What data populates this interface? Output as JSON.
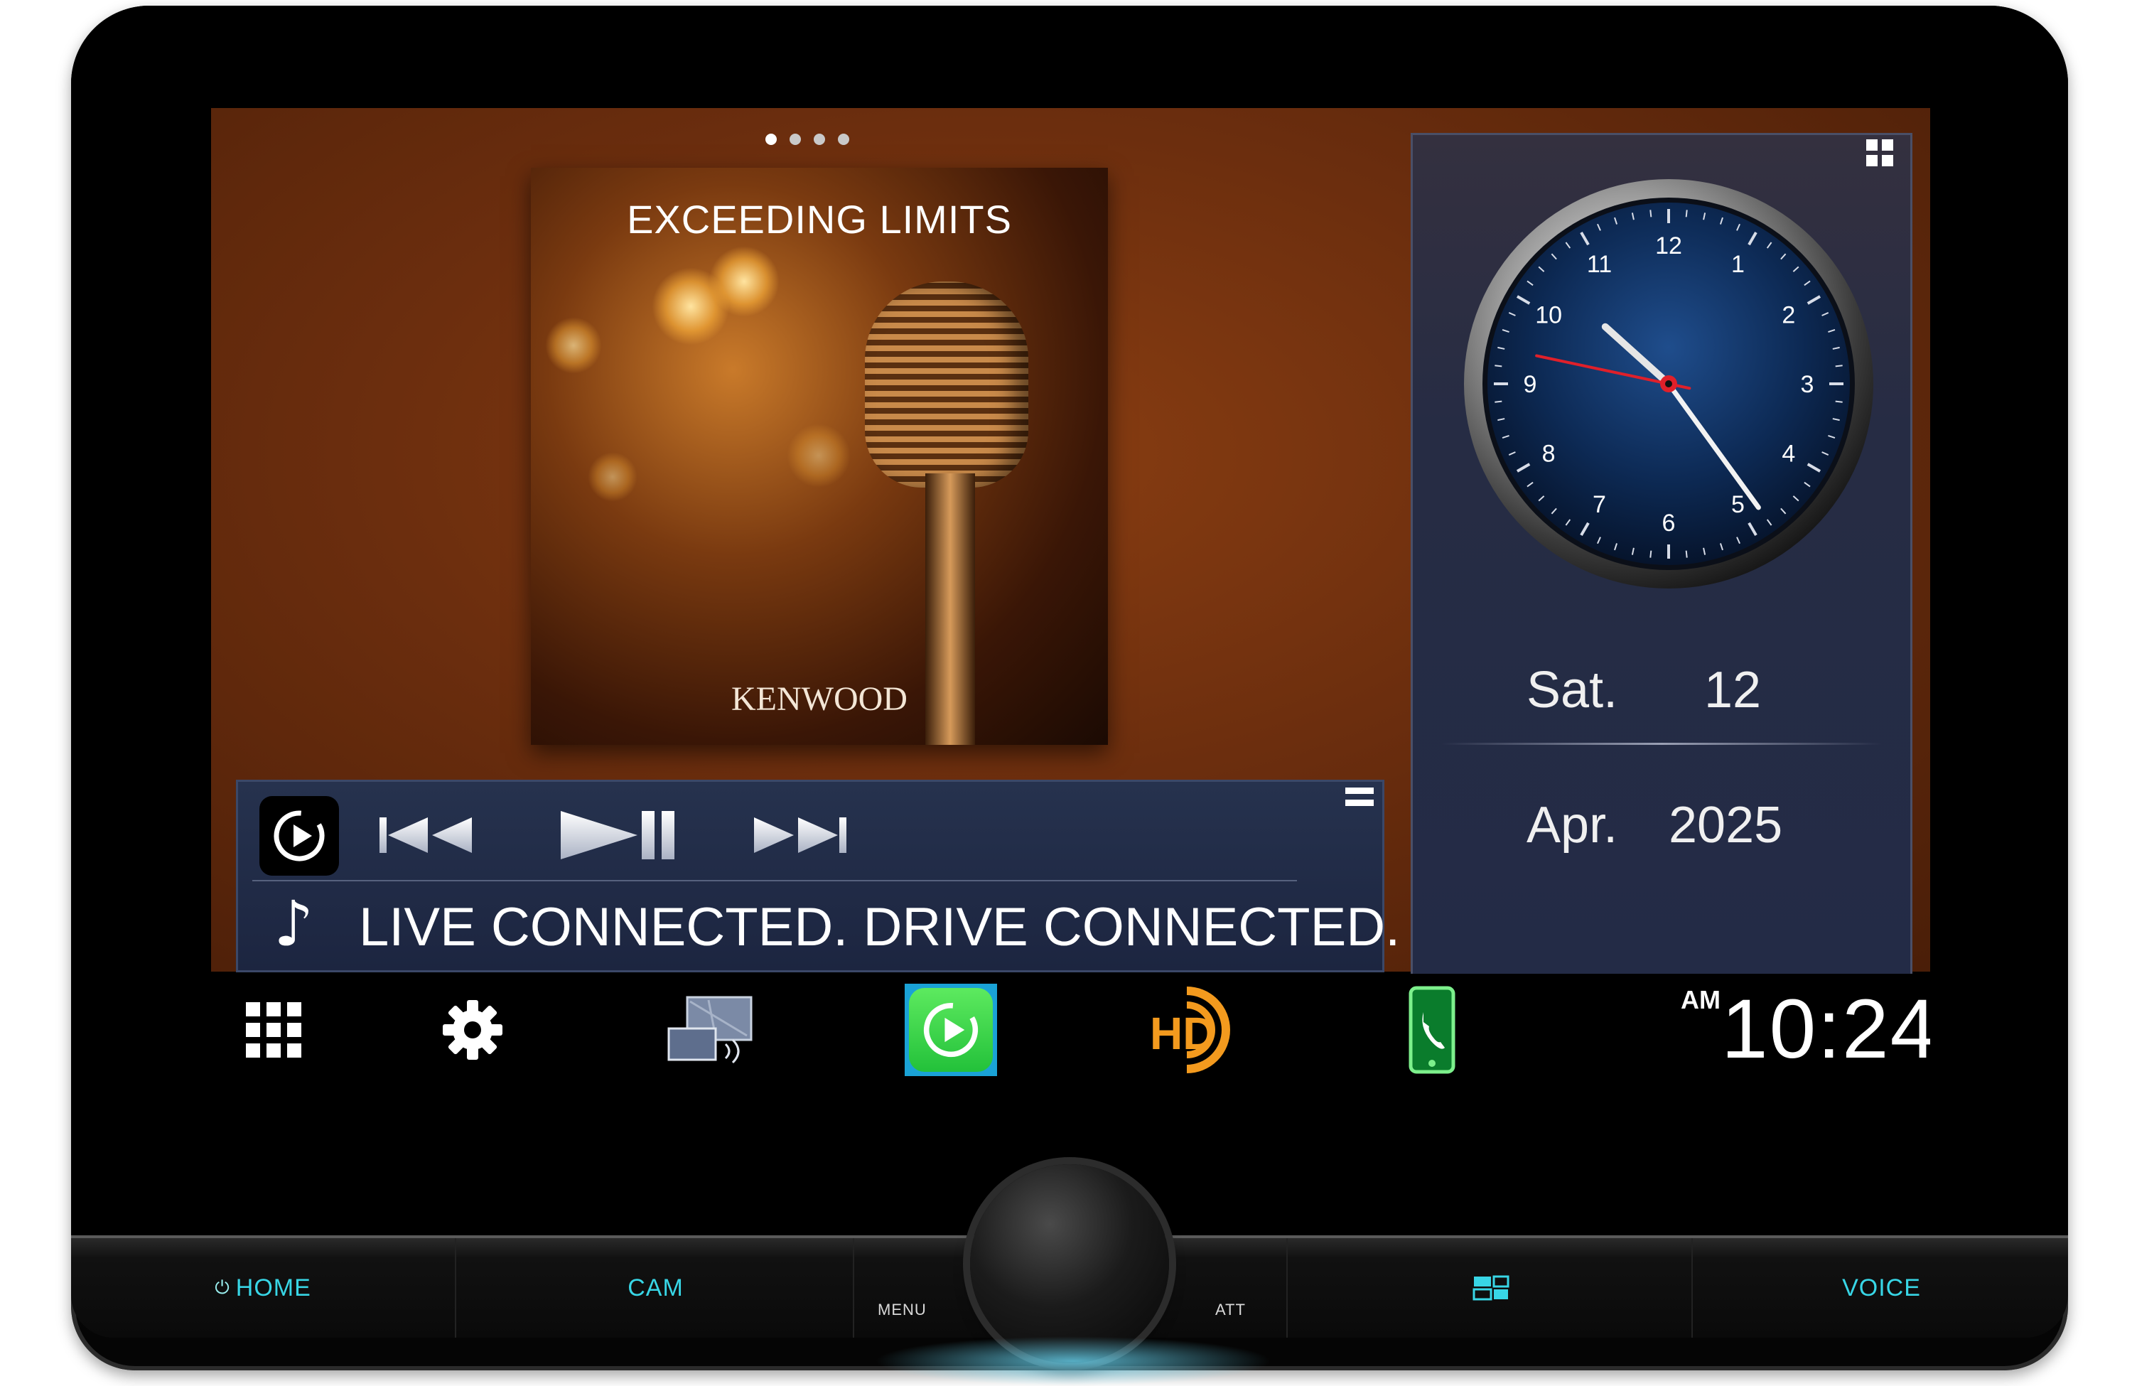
{
  "album": {
    "title": "EXCEEDING LIMITS",
    "brand": "KENWOOD"
  },
  "player": {
    "track_line": "LIVE CONNECTED. DRIVE CONNECTED.",
    "note_glyph": "♪",
    "source_icon": "carplay-icon",
    "controls": [
      "previous-icon",
      "play-pause-icon",
      "next-icon"
    ]
  },
  "page_indicator": {
    "pages": 4,
    "active": 1
  },
  "clock_widget": {
    "hour_numbers": [
      "12",
      "1",
      "2",
      "3",
      "4",
      "5",
      "6",
      "7",
      "8",
      "9",
      "10",
      "11"
    ],
    "time_shown": "10:24",
    "weekday": "Sat.",
    "day": "12",
    "month": "Apr.",
    "year": "2025"
  },
  "dock": {
    "items": [
      "apps-grid-icon",
      "settings-gear-icon",
      "screen-mirroring-icon",
      "carplay-icon",
      "hd-radio-icon",
      "phone-icon"
    ],
    "ampm": "AM",
    "time": "10:24"
  },
  "hardware": {
    "home": "HOME",
    "cam": "CAM",
    "menu": "MENU",
    "att": "ATT",
    "voice": "VOICE"
  },
  "colors": {
    "accent_cyan": "#38d6e6",
    "hd_orange": "#f39a1e",
    "carplay_green": "#34c759",
    "second_hand_red": "#e0202a"
  }
}
